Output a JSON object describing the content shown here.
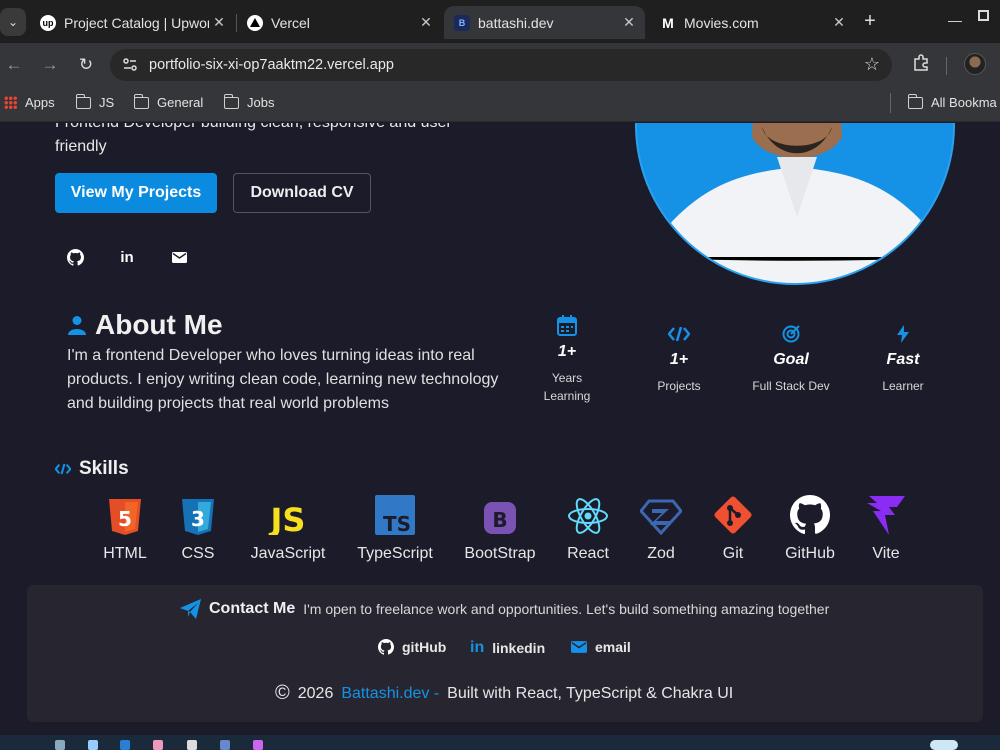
{
  "browser": {
    "tabs": [
      {
        "title": "Project Catalog | Upwork",
        "favicon": "up",
        "active": false
      },
      {
        "title": "Vercel",
        "favicon": "vercel",
        "active": false
      },
      {
        "title": "battashi.dev",
        "favicon": "B",
        "active": true
      },
      {
        "title": "Movies.com",
        "favicon": "M",
        "active": false
      }
    ],
    "url": "portfolio-six-xi-op7aaktm22.vercel.app",
    "bookmarks": [
      {
        "label": "Apps",
        "icon": "apps-grid-icon"
      },
      {
        "label": "JS",
        "icon": "folder-icon"
      },
      {
        "label": "General",
        "icon": "folder-icon"
      },
      {
        "label": "Jobs",
        "icon": "folder-icon"
      }
    ],
    "all_bookmarks": "All Bookma"
  },
  "hero": {
    "intro_text": "Frontend Developer building clean, responsive and user friendly",
    "primary_button": "View My Projects",
    "secondary_button": "Download CV",
    "socials": [
      "github-icon",
      "linkedin-icon",
      "email-icon"
    ]
  },
  "about": {
    "title": "About Me",
    "text": "I'm a frontend Developer who loves turning ideas into real products. I enjoy writing clean code, learning new technology and building projects that real world problems",
    "stats": [
      {
        "icon": "calendar-icon",
        "value": "1+",
        "label": "Years Learning"
      },
      {
        "icon": "code-icon",
        "value": "1+",
        "label": "Projects"
      },
      {
        "icon": "target-icon",
        "value": "Goal",
        "label": "Full Stack Dev"
      },
      {
        "icon": "bolt-icon",
        "value": "Fast",
        "label": "Learner"
      }
    ]
  },
  "skills": {
    "title": "Skills",
    "items": [
      "HTML",
      "CSS",
      "JavaScript",
      "TypeScript",
      "BootStrap",
      "React",
      "Zod",
      "Git",
      "GitHub",
      "Vite"
    ]
  },
  "contact": {
    "title": "Contact Me",
    "subtitle": "I'm open to freelance work and opportunities. Let's build something amazing together",
    "links": [
      {
        "icon": "github-icon",
        "label": "gitHub"
      },
      {
        "icon": "linkedin-icon",
        "label": "linkedin"
      },
      {
        "icon": "email-icon",
        "label": "email"
      }
    ],
    "footer": {
      "year": "2026",
      "brand": "Battashi.dev -",
      "built_with": "Built with React, TypeScript & Chakra UI"
    }
  },
  "colors": {
    "accent": "#1592e6",
    "background": "#1c1b29",
    "card": "#272630"
  }
}
